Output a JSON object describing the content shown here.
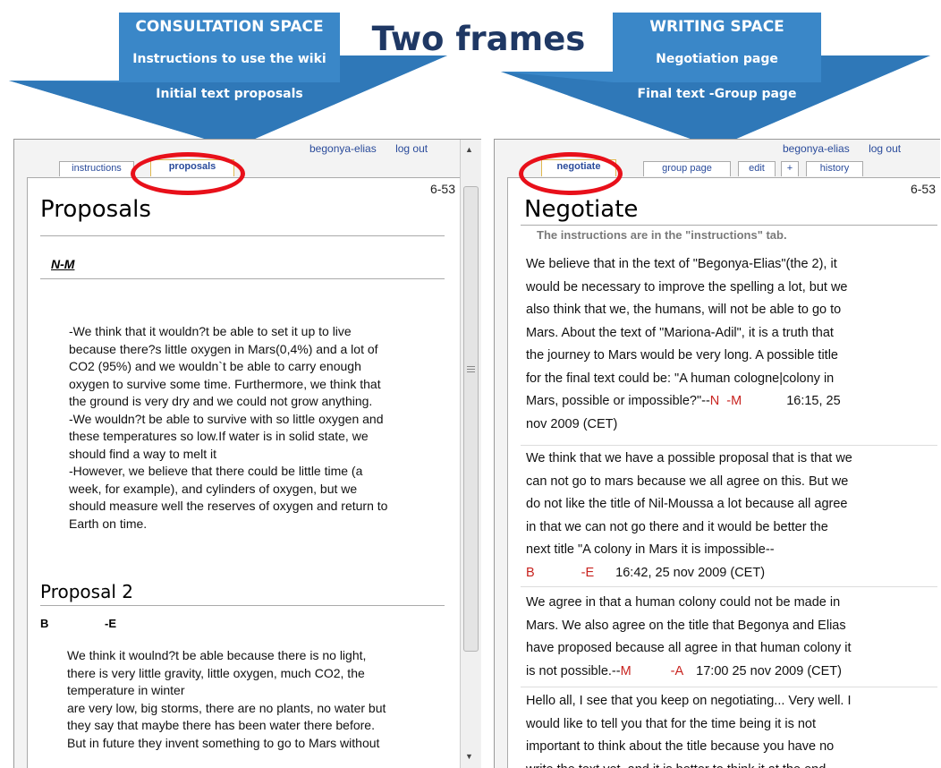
{
  "banner": {
    "title": "Two frames",
    "left": {
      "title": "CONSULTATION SPACE",
      "line1": "Instructions to use the wiki",
      "line2": "Initial text proposals"
    },
    "right": {
      "title": "WRITING SPACE",
      "line1": "Negotiation page",
      "line2": "Final text -Group page"
    },
    "colors": {
      "arrow": "#3a87c8",
      "title": "#1f3864",
      "ring": "#e8101a"
    }
  },
  "left_frame": {
    "user": "begonya-elias",
    "logout": "log out",
    "tabs": [
      "instructions",
      "proposals"
    ],
    "page_number": "6-53",
    "title": "Proposals",
    "section1_author": "N-M",
    "section1_lines": [
      "-We think that it wouldn?t be able to set it up to live",
      "because there?s little oxygen in Mars(0,4%) and a lot of",
      "CO2 (95%) and we wouldn`t be able to carry enough",
      "oxygen to survive some time. Furthermore, we think that",
      "the ground is very dry and we could not grow anything.",
      "-We wouldn?t be able to survive with so little oxygen and",
      "these temperatures so low.If water is in solid state, we",
      "should find a way to melt it",
      "-However, we believe that there could be little time (a",
      "week, for example), and cylinders of oxygen, but we",
      "should measure well the reserves of oxygen and return to",
      "Earth on time."
    ],
    "section2_title": "Proposal 2",
    "section2_author_a": "B",
    "section2_author_b": "-E",
    "section2_lines": [
      "We think it woulnd?t be able because there is no light,",
      "there is very little gravity, little oxygen, much CO2, the",
      "temperature in winter",
      "are very low, big storms, there are no plants, no water but",
      "they say that maybe there has been water there before.",
      "But in future they invent something to go to Mars without"
    ]
  },
  "right_frame": {
    "user": "begonya-elias",
    "logout": "log out",
    "tabs": [
      "negotiate",
      "group page",
      "edit",
      "+",
      "history"
    ],
    "page_number": "6-53",
    "title": "Negotiate",
    "subtitle": "The instructions are in the \"instructions\" tab.",
    "p1_lines": [
      "We believe that in the text of \"Begonya-Elias\"(the 2), it",
      "would be necessary to improve the spelling a lot, but we",
      "also think that we, the humans, will not be able to go to",
      "Mars. About the text of \"Mariona-Adil\", it is a truth that",
      "the journey to Mars would be very long. A possible title",
      "for the final text could be: \"A human cologne|colony in"
    ],
    "p1_last": "Mars, possible or impossible?\"--",
    "p1_sig_a": "N",
    "p1_sig_b": "-M",
    "p1_time": "16:15, 25",
    "p1_time2": "nov 2009 (CET)",
    "p2_lines": [
      "We think that we have a possible proposal that is that we",
      "can not go to mars because we all agree on this. But we",
      "do not like the title of Nil-Moussa a lot because all agree",
      "in that we can not go there and it would be better the",
      "next title \"A colony in Mars it is impossible--"
    ],
    "p2_sig_a": "B",
    "p2_sig_b": "-E",
    "p2_time": "16:42, 25 nov 2009 (CET)",
    "p3_lines": [
      "We agree in that a human colony could not be made in",
      "Mars. We also agree on the title that Begonya and Elias",
      "have proposed because all agree in that human colony it"
    ],
    "p3_last": "is not possible.--",
    "p3_sig_a": "M",
    "p3_sig_b": "-A",
    "p3_time": "17:00 25 nov 2009 (CET)",
    "p4_lines": [
      "Hello all, I see that you keep on negotiating... Very well. I",
      "would like to tell you that for the time being it is not",
      "important to think about the title because you have no",
      "write the text yet, and it is better to think it at the end"
    ]
  }
}
